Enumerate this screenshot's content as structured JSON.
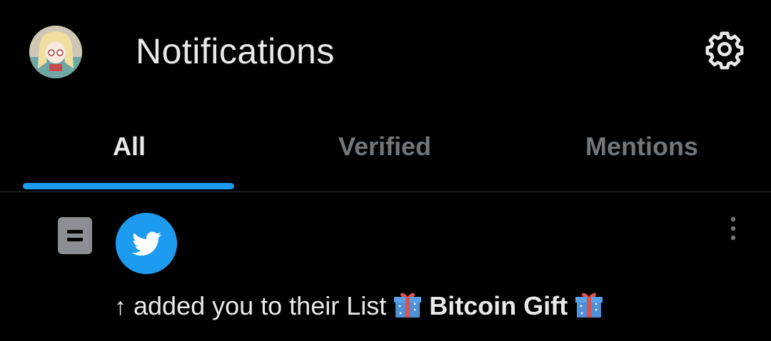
{
  "header": {
    "title": "Notifications",
    "avatar_icon": "user-avatar",
    "settings_icon": "gear-icon"
  },
  "tabs": [
    {
      "label": "All",
      "active": true
    },
    {
      "label": "Verified",
      "active": false
    },
    {
      "label": "Mentions",
      "active": false
    }
  ],
  "notification": {
    "type_icon": "list-icon",
    "actor_icon": "twitter-bird-icon",
    "prefix": "↑",
    "text": " added you to their List ",
    "list_name": "Bitcoin Gift",
    "more_icon": "more-vertical-icon"
  },
  "colors": {
    "background": "#000000",
    "accent": "#1d9bf0",
    "text_primary": "#e7e9ea",
    "text_secondary": "#71767b",
    "divider": "#2f3336"
  }
}
